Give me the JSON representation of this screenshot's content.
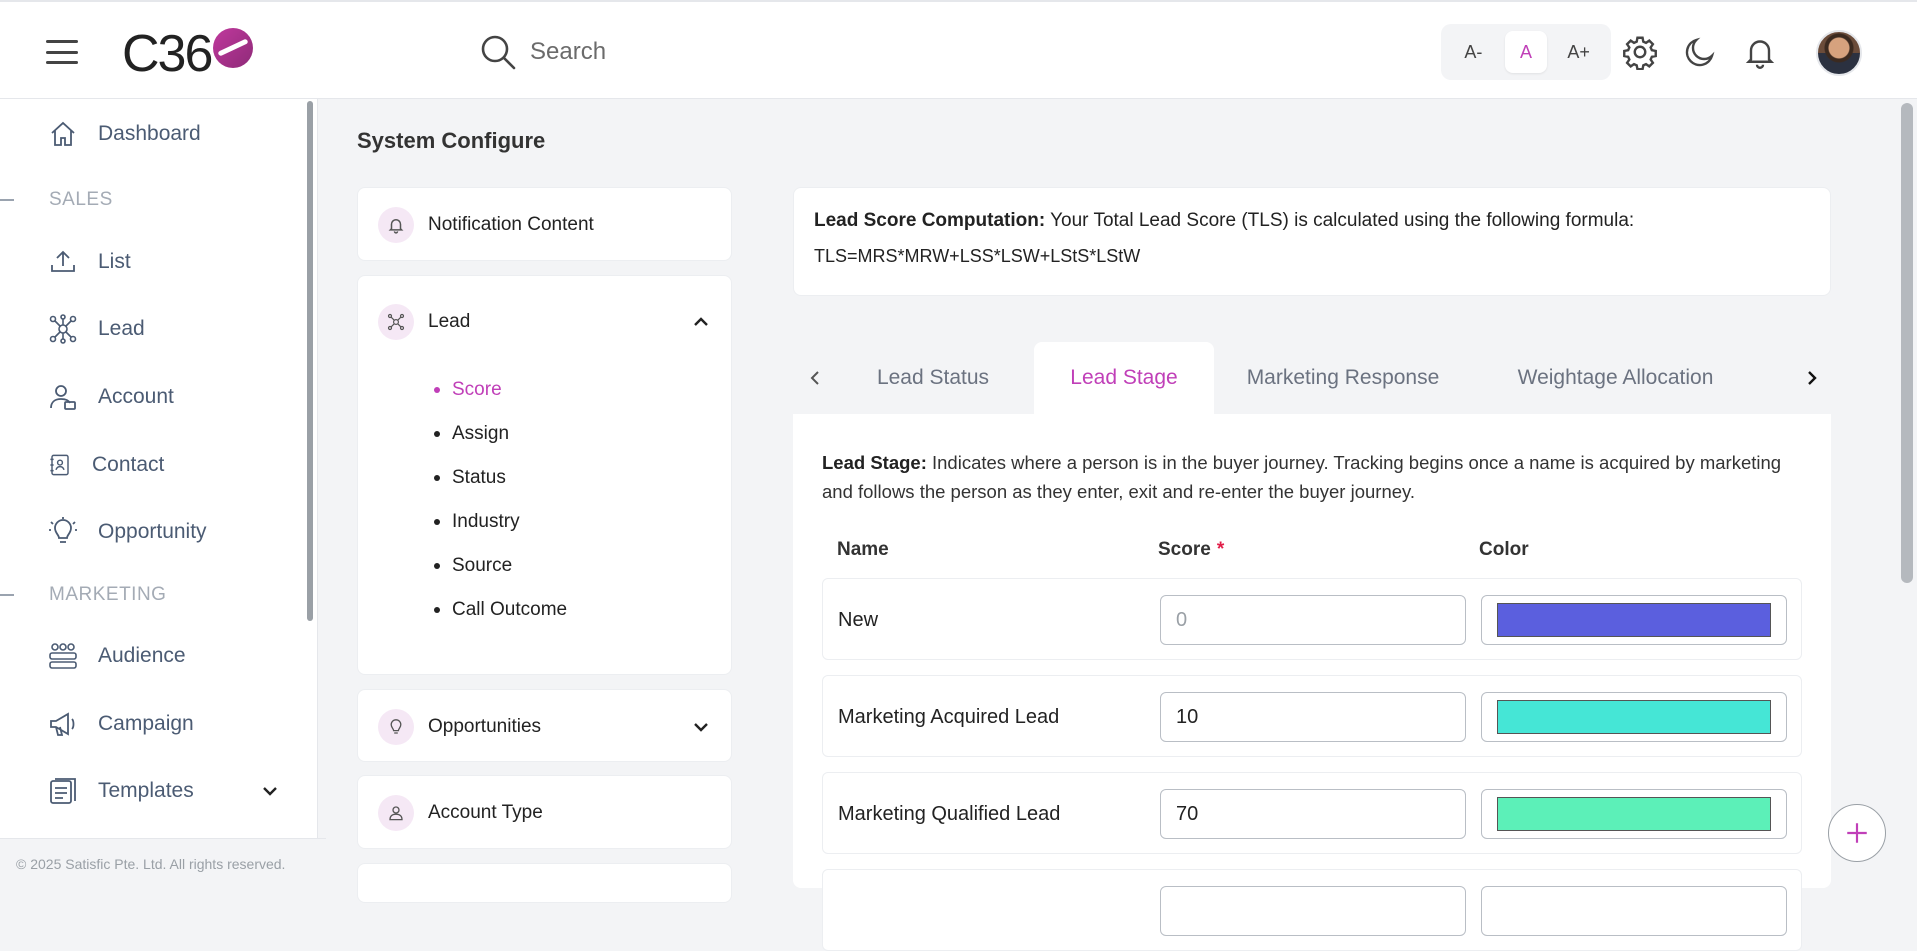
{
  "header": {
    "logo_text": "C36",
    "search_placeholder": "Search",
    "font_decrease": "A-",
    "font_normal": "A",
    "font_increase": "A+"
  },
  "sidebar": {
    "items": [
      {
        "label": "Dashboard",
        "icon": "home-icon"
      },
      {
        "section": "SALES"
      },
      {
        "label": "List",
        "icon": "upload-icon"
      },
      {
        "label": "Lead",
        "icon": "network-icon"
      },
      {
        "label": "Account",
        "icon": "user-card-icon"
      },
      {
        "label": "Contact",
        "icon": "contact-book-icon"
      },
      {
        "label": "Opportunity",
        "icon": "lightbulb-icon"
      },
      {
        "section": "MARKETING"
      },
      {
        "label": "Audience",
        "icon": "audience-icon"
      },
      {
        "label": "Campaign",
        "icon": "megaphone-icon"
      },
      {
        "label": "Templates",
        "icon": "templates-icon"
      }
    ],
    "copyright": "© 2025 Satisfic Pte. Ltd. All rights reserved."
  },
  "main": {
    "title": "System Configure",
    "config_menu": {
      "notification": "Notification Content",
      "lead": "Lead",
      "lead_subitems": [
        "Score",
        "Assign",
        "Status",
        "Industry",
        "Source",
        "Call Outcome"
      ],
      "active_subitem": "Score",
      "opportunities": "Opportunities",
      "account_type": "Account Type"
    },
    "formula": {
      "label": "Lead Score Computation:",
      "text": " Your Total Lead Score (TLS) is calculated using the following formula:",
      "expression": "TLS=MRS*MRW+LSS*LSW+LStS*LStW"
    },
    "tabs": [
      "Lead Status",
      "Lead Stage",
      "Marketing Response",
      "Weightage Allocation"
    ],
    "active_tab": "Lead Stage",
    "stage": {
      "desc_label": "Lead Stage:",
      "desc_text": "  Indicates where a person is in the buyer journey. Tracking begins once a name is acquired by marketing and follows the person as they enter, exit and re-enter the buyer journey.",
      "col_name": "Name",
      "col_score": "Score",
      "col_required": "*",
      "col_color": "Color",
      "rows": [
        {
          "name": "New",
          "score": "",
          "placeholder": "0",
          "color": "#5b5fde"
        },
        {
          "name": "Marketing Acquired Lead",
          "score": "10",
          "placeholder": "",
          "color": "#45e6d6"
        },
        {
          "name": "Marketing Qualified Lead",
          "score": "70",
          "placeholder": "",
          "color": "#5cf0b8"
        }
      ]
    }
  },
  "colors": {
    "accent": "#c03fb8"
  }
}
